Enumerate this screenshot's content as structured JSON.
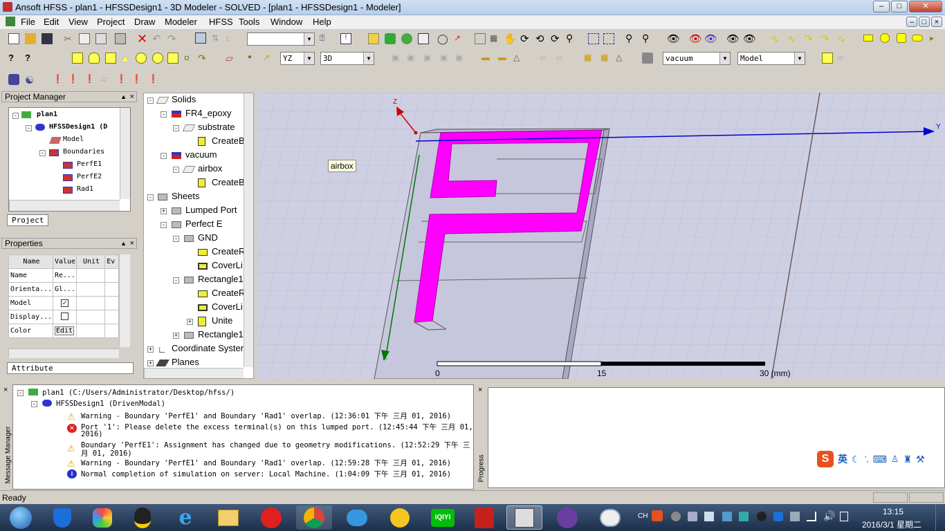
{
  "window": {
    "title": "Ansoft HFSS  - plan1 - HFSSDesign1 - 3D Modeler - SOLVED - [plan1 - HFSSDesign1 - Modeler]"
  },
  "menu": [
    "File",
    "Edit",
    "View",
    "Project",
    "Draw",
    "Modeler",
    "HFSS",
    "Tools",
    "Window",
    "Help"
  ],
  "toolbar": {
    "plane_select": "YZ",
    "dim_select": "3D",
    "material_select": "vacuum",
    "model_select": "Model"
  },
  "project_manager": {
    "title": "Project Manager",
    "items": [
      "plan1",
      "HFSSDesign1 (D",
      "Model",
      "Boundaries",
      "PerfE1",
      "PerfE2",
      "Rad1"
    ],
    "tab": "Project"
  },
  "properties": {
    "title": "Properties",
    "headers": [
      "Name",
      "Value",
      "Unit",
      "Ev"
    ],
    "rows": [
      {
        "name": "Name",
        "value": "Re..."
      },
      {
        "name": "Orienta...",
        "value": "Gl..."
      },
      {
        "name": "Model",
        "value": ""
      },
      {
        "name": "Display...",
        "value": ""
      },
      {
        "name": "Color",
        "value": "Edit"
      }
    ],
    "tab": "Attribute"
  },
  "model_tree": {
    "items": [
      "Solids",
      "FR4_epoxy",
      "substrate",
      "CreateB",
      "vacuum",
      "airbox",
      "CreateB",
      "Sheets",
      "Lumped Port",
      "Perfect E",
      "GND",
      "CreateR",
      "CoverLi",
      "Rectangle1",
      "CreateR",
      "CoverLi",
      "Unite",
      "Rectangle1",
      "Coordinate Syster",
      "Planes"
    ]
  },
  "viewport": {
    "tooltip": "airbox",
    "axis_z": "Z",
    "axis_y": "Y",
    "axis_x": "X",
    "scale_labels": [
      "0",
      "15",
      "30 (mm)"
    ],
    "colors": {
      "background": "#cfcfe4",
      "antenna": "#ff00ff",
      "y_axis": "#0000cc",
      "z_axis": "#cc0000",
      "x_axis": "#007700"
    }
  },
  "messages": {
    "side_label": "Message Manager",
    "project": "plan1 (C:/Users/Administrator/Desktop/hfss/)",
    "design": "HFSSDesign1 (DrivenModal)",
    "items": [
      {
        "type": "warning",
        "text": "Warning - Boundary 'PerfE1' and Boundary 'Rad1' overlap. (12:36:01 下午  三月 01, 2016)"
      },
      {
        "type": "error",
        "text1": "Port '1': Please delete the excess terminal(s) on this lumped port. (12:45:44 下午  三月 01,",
        "text2": "2016)"
      },
      {
        "type": "warning",
        "text1": "Boundary 'PerfE1': Assignment has changed due to geometry modifications. (12:52:29 下午  三",
        "text2": "月 01, 2016)"
      },
      {
        "type": "warning",
        "text": "Warning - Boundary 'PerfE1' and Boundary 'Rad1' overlap. (12:59:28 下午  三月 01, 2016)"
      },
      {
        "type": "info",
        "text": "Normal completion of simulation on server: Local Machine. (1:04:09 下午  三月 01, 2016)"
      }
    ]
  },
  "progress": {
    "label": "Progress"
  },
  "ime": {
    "label": "英"
  },
  "status": {
    "text": "Ready"
  },
  "taskbar": {
    "tray_lang": "CH",
    "time": "13:15",
    "date": "2016/3/1 星期二"
  }
}
